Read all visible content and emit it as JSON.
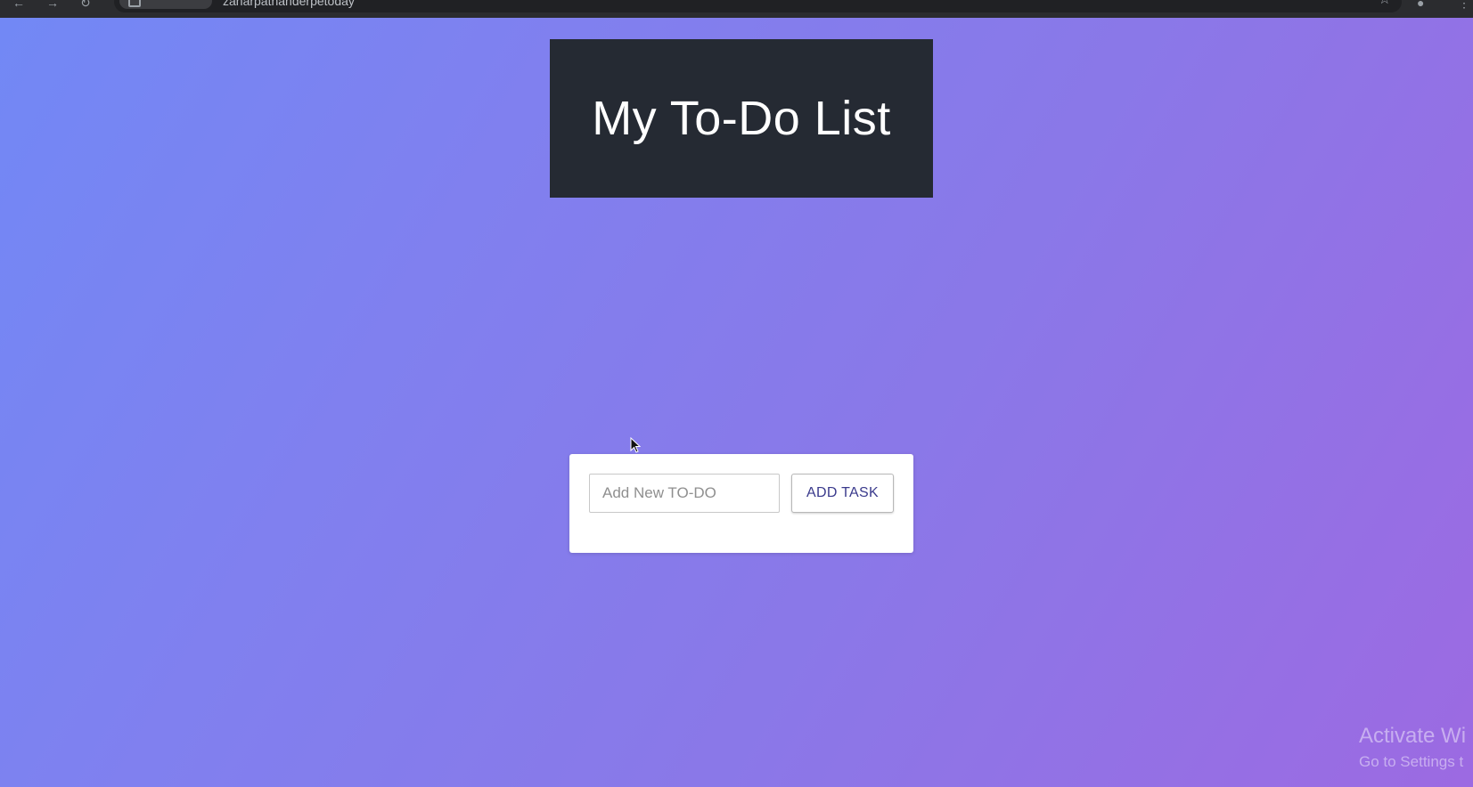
{
  "browser": {
    "url": "zaharpathanderpetoday"
  },
  "header": {
    "title": "My To-Do List"
  },
  "todo": {
    "input_placeholder": "Add New TO-DO",
    "input_value": "",
    "add_button_label": "ADD TASK"
  },
  "watermark": {
    "title": "Activate Wi",
    "subtitle": "Go to Settings t"
  },
  "colors": {
    "header_bg": "#252a33",
    "gradient_start": "#7288f5",
    "gradient_end": "#9c6ae2",
    "button_text": "#3a3a8c"
  },
  "icons": [
    "back-icon",
    "forward-icon",
    "reload-icon",
    "site-info-icon",
    "star-icon",
    "extension-icon",
    "menu-icon",
    "cursor-icon"
  ]
}
